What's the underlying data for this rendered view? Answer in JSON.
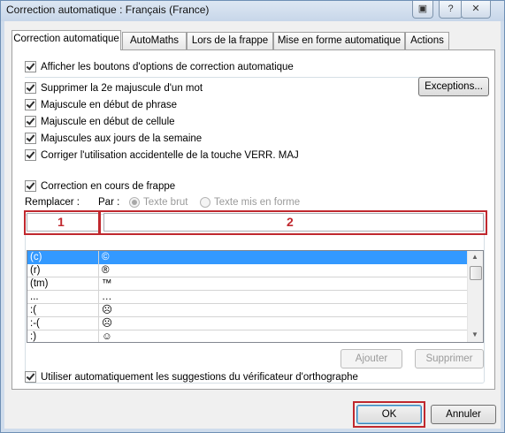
{
  "window": {
    "title": "Correction automatique : Français (France)",
    "title_buttons": [
      "help-icon",
      "close-icon"
    ],
    "question_mark": "?",
    "close_glyph": "✕"
  },
  "tabs": [
    {
      "label": "Correction automatique",
      "active": true
    },
    {
      "label": "AutoMaths",
      "active": false
    },
    {
      "label": "Lors de la frappe",
      "active": false
    },
    {
      "label": "Mise en forme automatique",
      "active": false
    },
    {
      "label": "Actions",
      "active": false
    }
  ],
  "options": {
    "show_buttons": {
      "label": "Afficher les boutons d'options de correction automatique",
      "checked": true
    },
    "items": [
      {
        "label": "Supprimer la 2e majuscule d'un mot",
        "checked": true
      },
      {
        "label": "Majuscule en début de phrase",
        "checked": true
      },
      {
        "label": "Majuscule en début de cellule",
        "checked": true
      },
      {
        "label": "Majuscules aux jours de la semaine",
        "checked": true
      },
      {
        "label": "Corriger l'utilisation accidentelle de la touche VERR. MAJ",
        "checked": true
      }
    ],
    "exceptions_label": "Exceptions..."
  },
  "replace_section": {
    "checkbox_label": "Correction en cours de frappe",
    "checked": true,
    "replace_label": "Remplacer :",
    "with_label": "Par :",
    "radio_plain": "Texte brut",
    "radio_formatted": "Texte mis en forme",
    "replace_value": "",
    "with_value": "",
    "annotation_1": "1",
    "annotation_2": "2",
    "entries": [
      {
        "from": "(c)",
        "to": "©",
        "selected": true
      },
      {
        "from": "(r)",
        "to": "®",
        "selected": false
      },
      {
        "from": "(tm)",
        "to": "™",
        "selected": false
      },
      {
        "from": "...",
        "to": "…",
        "selected": false
      },
      {
        "from": ":(",
        "to": "☹",
        "selected": false
      },
      {
        "from": ":-(",
        "to": "☹",
        "selected": false
      },
      {
        "from": ":)",
        "to": "☺",
        "selected": false
      }
    ],
    "add_label": "Ajouter",
    "delete_label": "Supprimer",
    "suggestions": {
      "label": "Utiliser automatiquement les suggestions du vérificateur d'orthographe",
      "checked": true
    }
  },
  "footer": {
    "ok_label": "OK",
    "cancel_label": "Annuler"
  },
  "colors": {
    "annotation_red": "#c0282e",
    "selection_blue": "#3399ff"
  }
}
